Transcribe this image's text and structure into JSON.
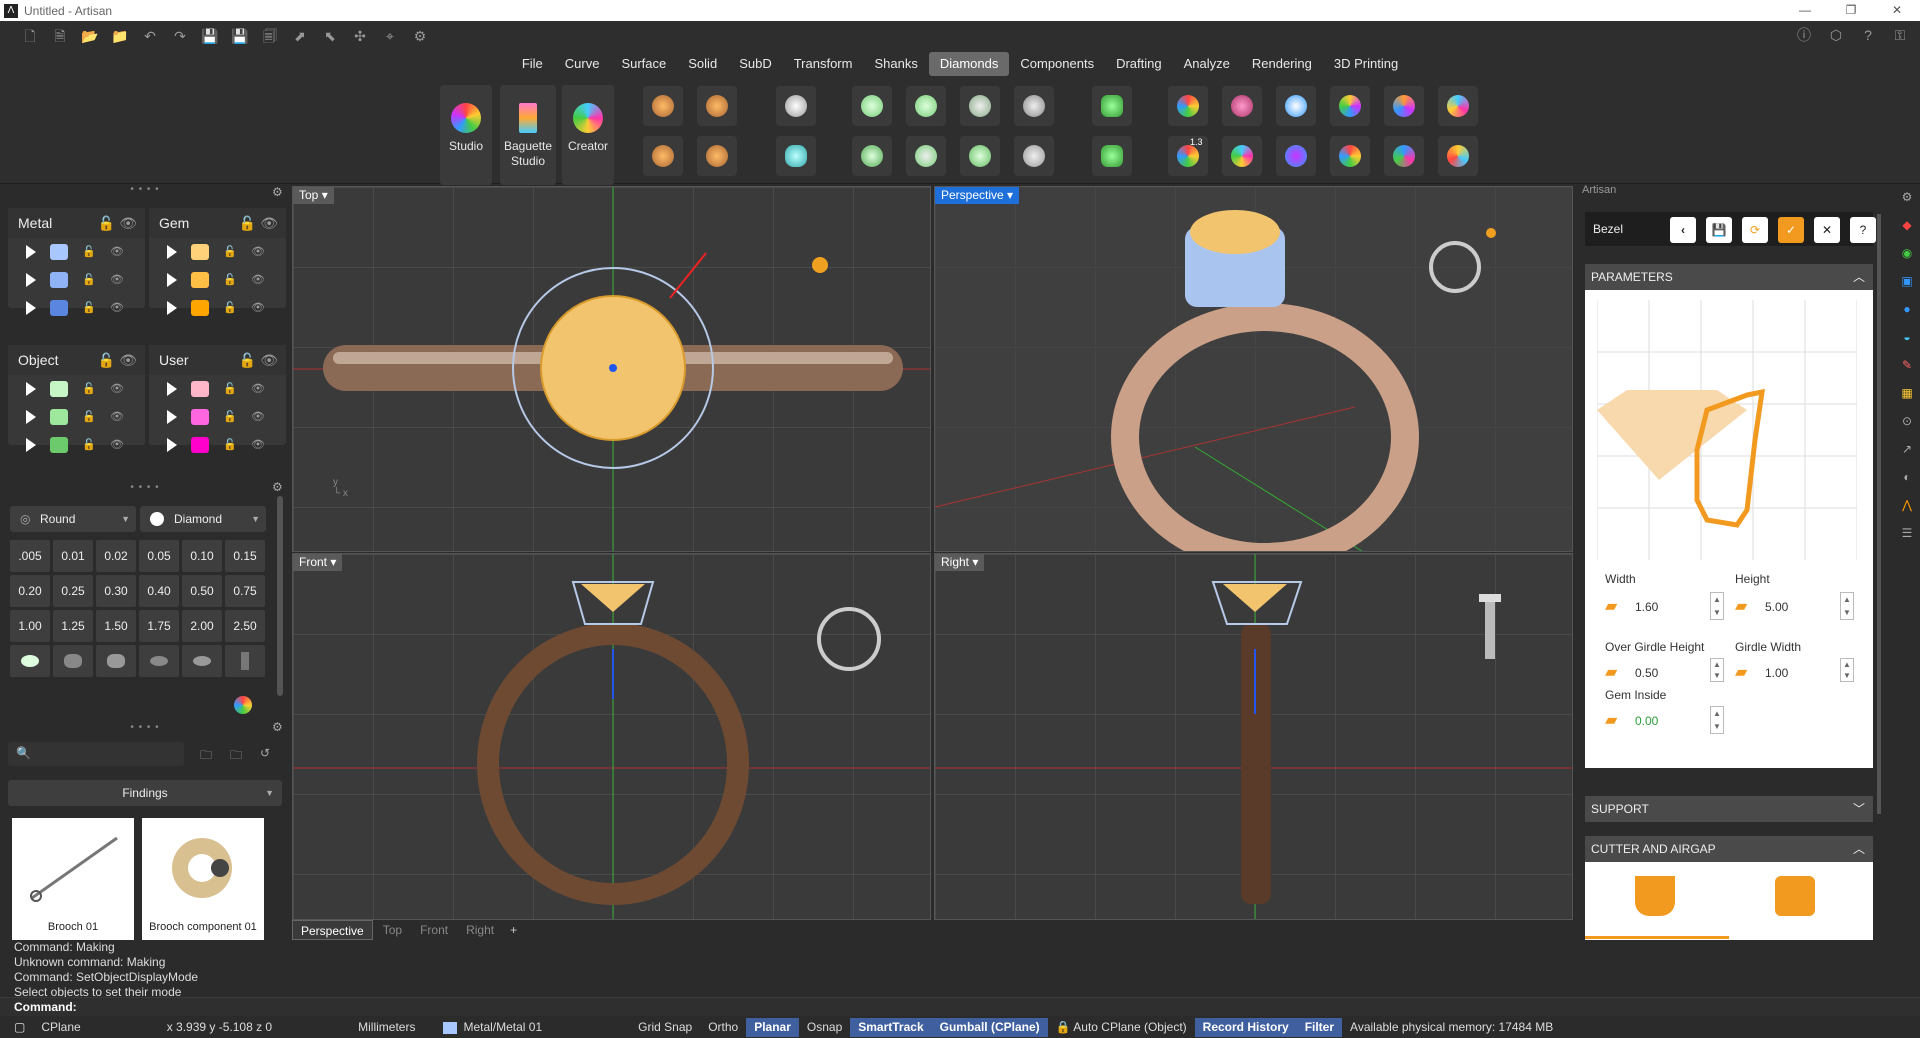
{
  "window": {
    "title": "Untitled - Artisan"
  },
  "menu": [
    "File",
    "Curve",
    "Surface",
    "Solid",
    "SubD",
    "Transform",
    "Shanks",
    "Diamonds",
    "Components",
    "Drafting",
    "Analyze",
    "Rendering",
    "3D Printing"
  ],
  "menu_active": "Diamonds",
  "ribbon": {
    "studio": "Studio",
    "baguette": "Baguette Studio",
    "creator": "Creator",
    "gem_label": "1.3"
  },
  "layers": {
    "metal": "Metal",
    "gem": "Gem",
    "object": "Object",
    "user": "User"
  },
  "gem_options": {
    "cut": "Round",
    "material": "Diamond"
  },
  "sizes": [
    ".005",
    "0.01",
    "0.02",
    "0.05",
    "0.10",
    "0.15",
    "0.20",
    "0.25",
    "0.30",
    "0.40",
    "0.50",
    "0.75",
    "1.00",
    "1.25",
    "1.50",
    "1.75",
    "2.00",
    "2.50"
  ],
  "library": {
    "category": "Findings",
    "items": [
      "Brooch 01",
      "Brooch component 01"
    ]
  },
  "viewports": {
    "top": "Top",
    "perspective": "Perspective",
    "front": "Front",
    "right": "Right"
  },
  "tabs": [
    "Perspective",
    "Top",
    "Front",
    "Right"
  ],
  "tab_add": "+",
  "rpanel": {
    "title": "Artisan",
    "tool": "Bezel",
    "parameters": "PARAMETERS",
    "width_label": "Width",
    "width_value": "1.60",
    "height_label": "Height",
    "height_value": "5.00",
    "over_girdle_label": "Over Girdle Height",
    "over_girdle_value": "0.50",
    "girdle_width_label": "Girdle Width",
    "girdle_width_value": "1.00",
    "gem_inside_label": "Gem Inside",
    "gem_inside_value": "0.00",
    "support": "SUPPORT",
    "cutter": "CUTTER AND AIRGAP"
  },
  "command": {
    "lines": [
      "Command: Making",
      "Unknown command: Making",
      "Command: SetObjectDisplayMode",
      "Select objects to set their mode"
    ],
    "prompt": "Command:"
  },
  "status": {
    "cplane": "CPlane",
    "coords": "x 3.939  y -5.108  z 0",
    "units": "Millimeters",
    "layer": "Metal/Metal 01",
    "gridsnap": "Grid Snap",
    "ortho": "Ortho",
    "planar": "Planar",
    "osnap": "Osnap",
    "smarttrack": "SmartTrack",
    "gumball": "Gumball (CPlane)",
    "autocplane": "Auto CPlane (Object)",
    "record": "Record History",
    "filter": "Filter",
    "memory": "Available physical memory: 17484 MB"
  }
}
